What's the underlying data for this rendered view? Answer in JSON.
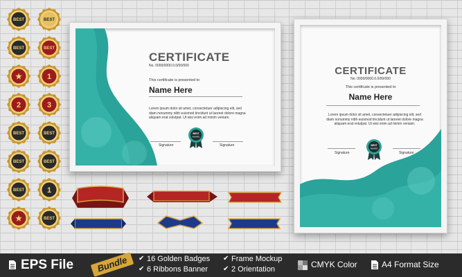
{
  "colors": {
    "teal": "#2aa39a",
    "dark": "#2b2b2b",
    "gold": "#d7a63a",
    "red": "#a82020",
    "blue": "#1d3a8a"
  },
  "landscape": {
    "title": "CERTIFICATE",
    "number": "No. 0000/0000.0.0/00/000",
    "presented": "This certificate is presented to",
    "name": "Name Here",
    "lorem": "Lorem ipsum dolor sit amet, consectetuer adipiscing elit, sed diam nonummy nibh euismod tincidunt ut laoreet dolore magna aliquam erat volutpat. Ut wisi enim ad minim veniam.",
    "signature1": "Signature",
    "signature2": "Signature",
    "badge": "BEST AWARD"
  },
  "portrait": {
    "title": "CERTIFICATE",
    "number": "No. 0000/0000.0.0/00/000",
    "presented": "This certificate is presented to",
    "name": "Name Here",
    "lorem": "Lorem ipsum dolor sit amet, consectetuer adipiscing elit, sed diam nonummy nibh euismod tincidunt ut laoreet dolore magna aliquam erat volutpat. Ut wisi enim ad minim veniam.",
    "signature1": "Signature",
    "signature2": "Signature",
    "badge": "BEST AWARD"
  },
  "badges": [
    {
      "text": "BEST",
      "style": "dark"
    },
    {
      "text": "BEST",
      "style": "gold"
    },
    {
      "text": "BEST",
      "style": "dark"
    },
    {
      "text": "BEST",
      "style": "red"
    },
    {
      "text": "★",
      "style": "red"
    },
    {
      "text": "1",
      "style": "red"
    },
    {
      "text": "2",
      "style": "red"
    },
    {
      "text": "3",
      "style": "red"
    },
    {
      "text": "BEST",
      "style": "dark"
    },
    {
      "text": "BEST",
      "style": "dark"
    },
    {
      "text": "BEST",
      "style": "dark"
    },
    {
      "text": "BEST",
      "style": "dark"
    },
    {
      "text": "BEST",
      "style": "dark"
    },
    {
      "text": "1",
      "style": "dark"
    },
    {
      "text": "★",
      "style": "red"
    },
    {
      "text": "BEST",
      "style": "dark"
    }
  ],
  "footer": {
    "eps": "EPS File",
    "bundle": "Bundle",
    "f1": "16 Golden Badges",
    "f2": "6  Ribbons Banner",
    "f3": "Frame Mockup",
    "f4": "2 Orientation",
    "f5": "CMYK Color",
    "f6": "A4 Format Size"
  }
}
